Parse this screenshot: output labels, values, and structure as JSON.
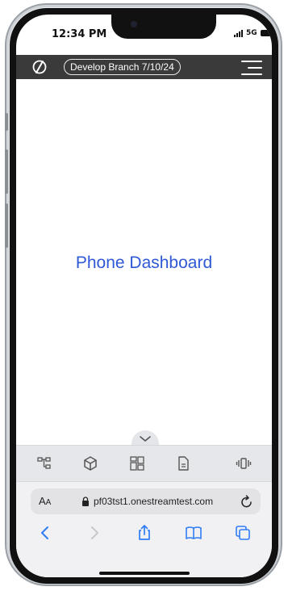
{
  "status": {
    "time": "12:34 PM",
    "network": "5G"
  },
  "app": {
    "branch_label": "Develop Branch 7/10/24"
  },
  "main": {
    "title": "Phone Dashboard"
  },
  "safari": {
    "aa_big": "A",
    "aa_small": "A",
    "url": "pf03tst1.onestreamtest.com"
  },
  "colors": {
    "accent": "#2f58d6",
    "appbar": "#3a3a3a"
  }
}
